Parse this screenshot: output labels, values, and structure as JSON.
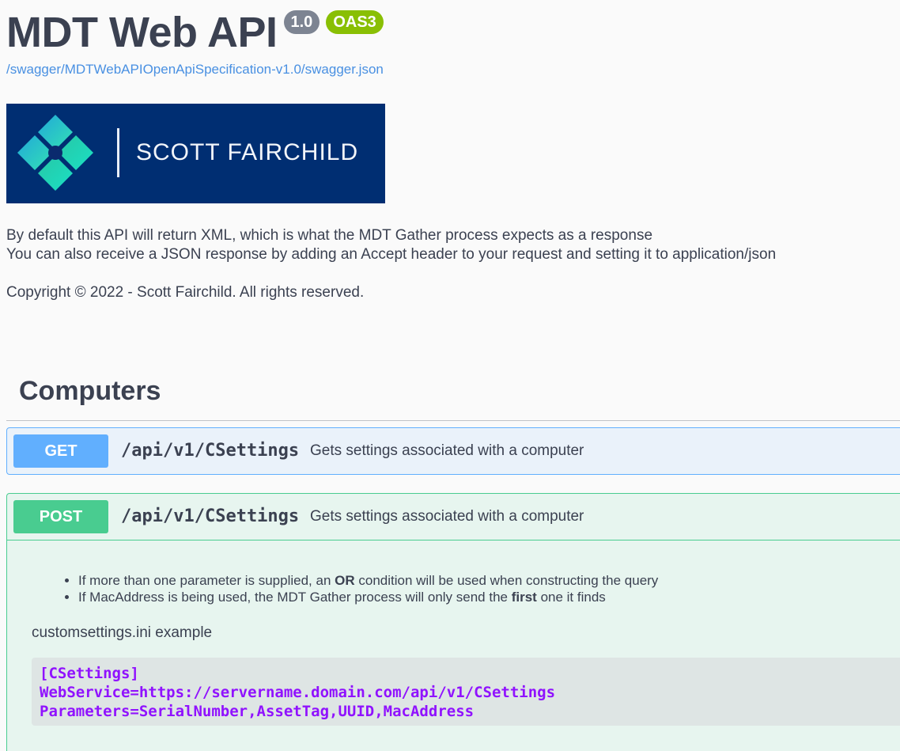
{
  "header": {
    "title": "MDT Web API",
    "version_badge": "1.0",
    "oas_badge": "OAS3",
    "spec_link": "/swagger/MDTWebAPIOpenApiSpecification-v1.0/swagger.json"
  },
  "logo": {
    "text": "SCOTT FAIRCHILD",
    "background_color": "#002e72",
    "icon": "diamond-logo-icon"
  },
  "description": {
    "line1": "By default this API will return XML, which is what the MDT Gather process expects as a response",
    "line2": "You can also receive a JSON response by adding an Accept header to your request and setting it to application/json",
    "copyright": "Copyright © 2022 - Scott Fairchild. All rights reserved."
  },
  "section": {
    "title": "Computers"
  },
  "operations": {
    "get": {
      "method": "GET",
      "path": "/api/v1/CSettings",
      "summary": "Gets settings associated with a computer",
      "color": "#61affe"
    },
    "post": {
      "method": "POST",
      "path": "/api/v1/CSettings",
      "summary": "Gets settings associated with a computer",
      "color": "#49cc90",
      "bullets": {
        "b1_pre": "If more than one parameter is supplied, an ",
        "b1_bold": "OR",
        "b1_post": " condition will be used when constructing the query",
        "b2_pre": "If MacAddress is being used, the MDT Gather process will only send the ",
        "b2_bold": "first",
        "b2_post": " one it finds"
      },
      "example_label": "customsettings.ini example",
      "code_lines": [
        "[CSettings]",
        "WebService=https://servername.domain.com/api/v1/CSettings",
        "Parameters=SerialNumber,AssetTag,UUID,MacAddress"
      ]
    }
  }
}
